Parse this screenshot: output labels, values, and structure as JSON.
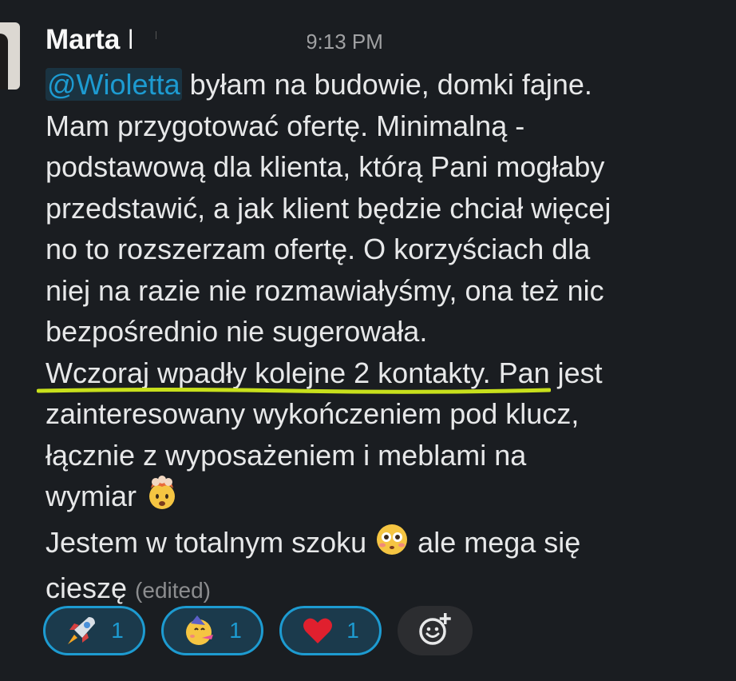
{
  "message": {
    "sender": "Marta B.",
    "time": "9:13 PM",
    "mention": "@Wioletta",
    "lines": [
      "była​m na budowie, domki fajne.",
      "Mam przygotować ofertę. Minimalną -",
      "podstawową dla klienta, którą Pani mogłaby",
      "przedstawić, a jak klient będzie chciał więcej",
      "no to rozszerzam ofertę. O korzyściach dla",
      "niej na razie nie rozmawiałyśmy, ona też nic",
      "bezpośrednio nie sugerowała.",
      "Wczoraj wpadły kolejne 2 kontakty. Pan jest",
      "zainteresowany wykończeniem pod klucz,",
      "łącznie z wyposażeniem i meblami na",
      "wymiar",
      "Jestem w totalnym szoku",
      "ale mega się",
      "cieszę"
    ],
    "edited_label": "(edited)",
    "inline_emojis": [
      "exploding-head",
      "flushed-face"
    ]
  },
  "reactions": [
    {
      "emoji": "rocket",
      "count": "1"
    },
    {
      "emoji": "partying-face",
      "count": "1"
    },
    {
      "emoji": "red-heart",
      "count": "1"
    }
  ],
  "colors": {
    "background": "#1a1d21",
    "mention": "#1d9bd1",
    "reaction_border": "#1d9bd1",
    "highlight_underline": "#c8e01c"
  }
}
